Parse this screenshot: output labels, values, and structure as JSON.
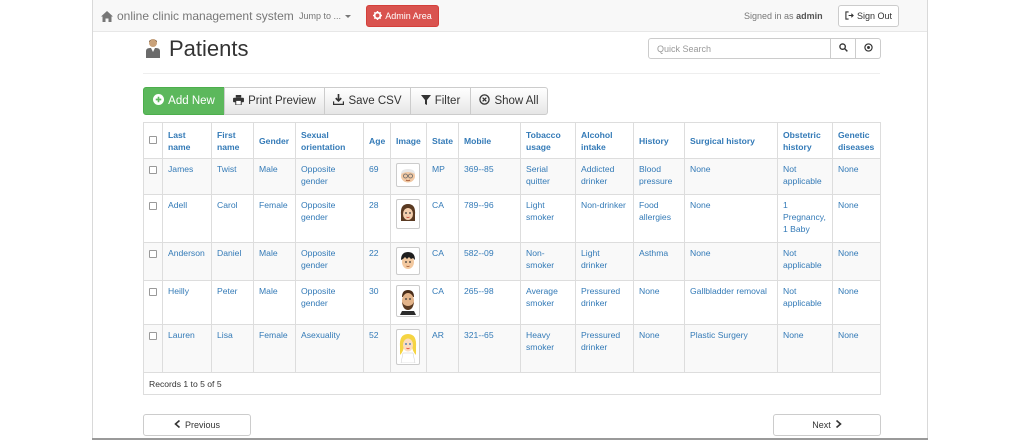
{
  "navbar": {
    "brand": "online clinic management system",
    "jump_to": "Jump to ...",
    "admin_area": "Admin Area",
    "signed_in_prefix": "Signed in as",
    "username": "admin",
    "sign_out": "Sign Out"
  },
  "page": {
    "title": "Patients",
    "search_placeholder": "Quick Search"
  },
  "toolbar": {
    "add_new": "Add New",
    "print_preview": "Print Preview",
    "save_csv": "Save CSV",
    "filter": "Filter",
    "show_all": "Show All"
  },
  "table": {
    "headers": [
      "Last name",
      "First name",
      "Gender",
      "Sexual orientation",
      "Age",
      "Image",
      "State",
      "Mobile",
      "Tobacco usage",
      "Alcohol intake",
      "History",
      "Surgical history",
      "Obstetric history",
      "Genetic diseases"
    ],
    "rows": [
      {
        "last": "James",
        "first": "Twist",
        "gender": "Male",
        "orientation": "Opposite gender",
        "age": "69",
        "image": "elderly-man-avatar",
        "state": "MP",
        "mobile": "369--85",
        "tobacco": "Serial quitter",
        "alcohol": "Addicted drinker",
        "history": "Blood pressure",
        "surgical": "None",
        "obstetric": "Not applicable",
        "genetic": "None"
      },
      {
        "last": "Adell",
        "first": "Carol",
        "gender": "Female",
        "orientation": "Opposite gender",
        "age": "28",
        "image": "woman-avatar",
        "state": "CA",
        "mobile": "789--96",
        "tobacco": "Light smoker",
        "alcohol": "Non-drinker",
        "history": "Food allergies",
        "surgical": "None",
        "obstetric": "1 Pregnancy, 1 Baby",
        "genetic": "None"
      },
      {
        "last": "Anderson",
        "first": "Daniel",
        "gender": "Male",
        "orientation": "Opposite gender",
        "age": "22",
        "image": "young-man-avatar",
        "state": "CA",
        "mobile": "582--09",
        "tobacco": "Non-smoker",
        "alcohol": "Light drinker",
        "history": "Asthma",
        "surgical": "None",
        "obstetric": "Not applicable",
        "genetic": "None"
      },
      {
        "last": "Heilly",
        "first": "Peter",
        "gender": "Male",
        "orientation": "Opposite gender",
        "age": "30",
        "image": "bearded-man-avatar",
        "state": "CA",
        "mobile": "265--98",
        "tobacco": "Average smoker",
        "alcohol": "Pressured drinker",
        "history": "None",
        "surgical": "Gallbladder removal",
        "obstetric": "Not applicable",
        "genetic": "None"
      },
      {
        "last": "Lauren",
        "first": "Lisa",
        "gender": "Female",
        "orientation": "Asexuality",
        "age": "52",
        "image": "blonde-woman-avatar",
        "state": "AR",
        "mobile": "321--65",
        "tobacco": "Heavy smoker",
        "alcohol": "Pressured drinker",
        "history": "None",
        "surgical": "Plastic Surgery",
        "obstetric": "None",
        "genetic": "None"
      }
    ],
    "records_text": "Records 1 to 5 of 5"
  },
  "pager": {
    "previous": "Previous",
    "next": "Next"
  },
  "colors": {
    "link": "#337ab7",
    "danger": "#d9534f",
    "success": "#5cb85c"
  }
}
